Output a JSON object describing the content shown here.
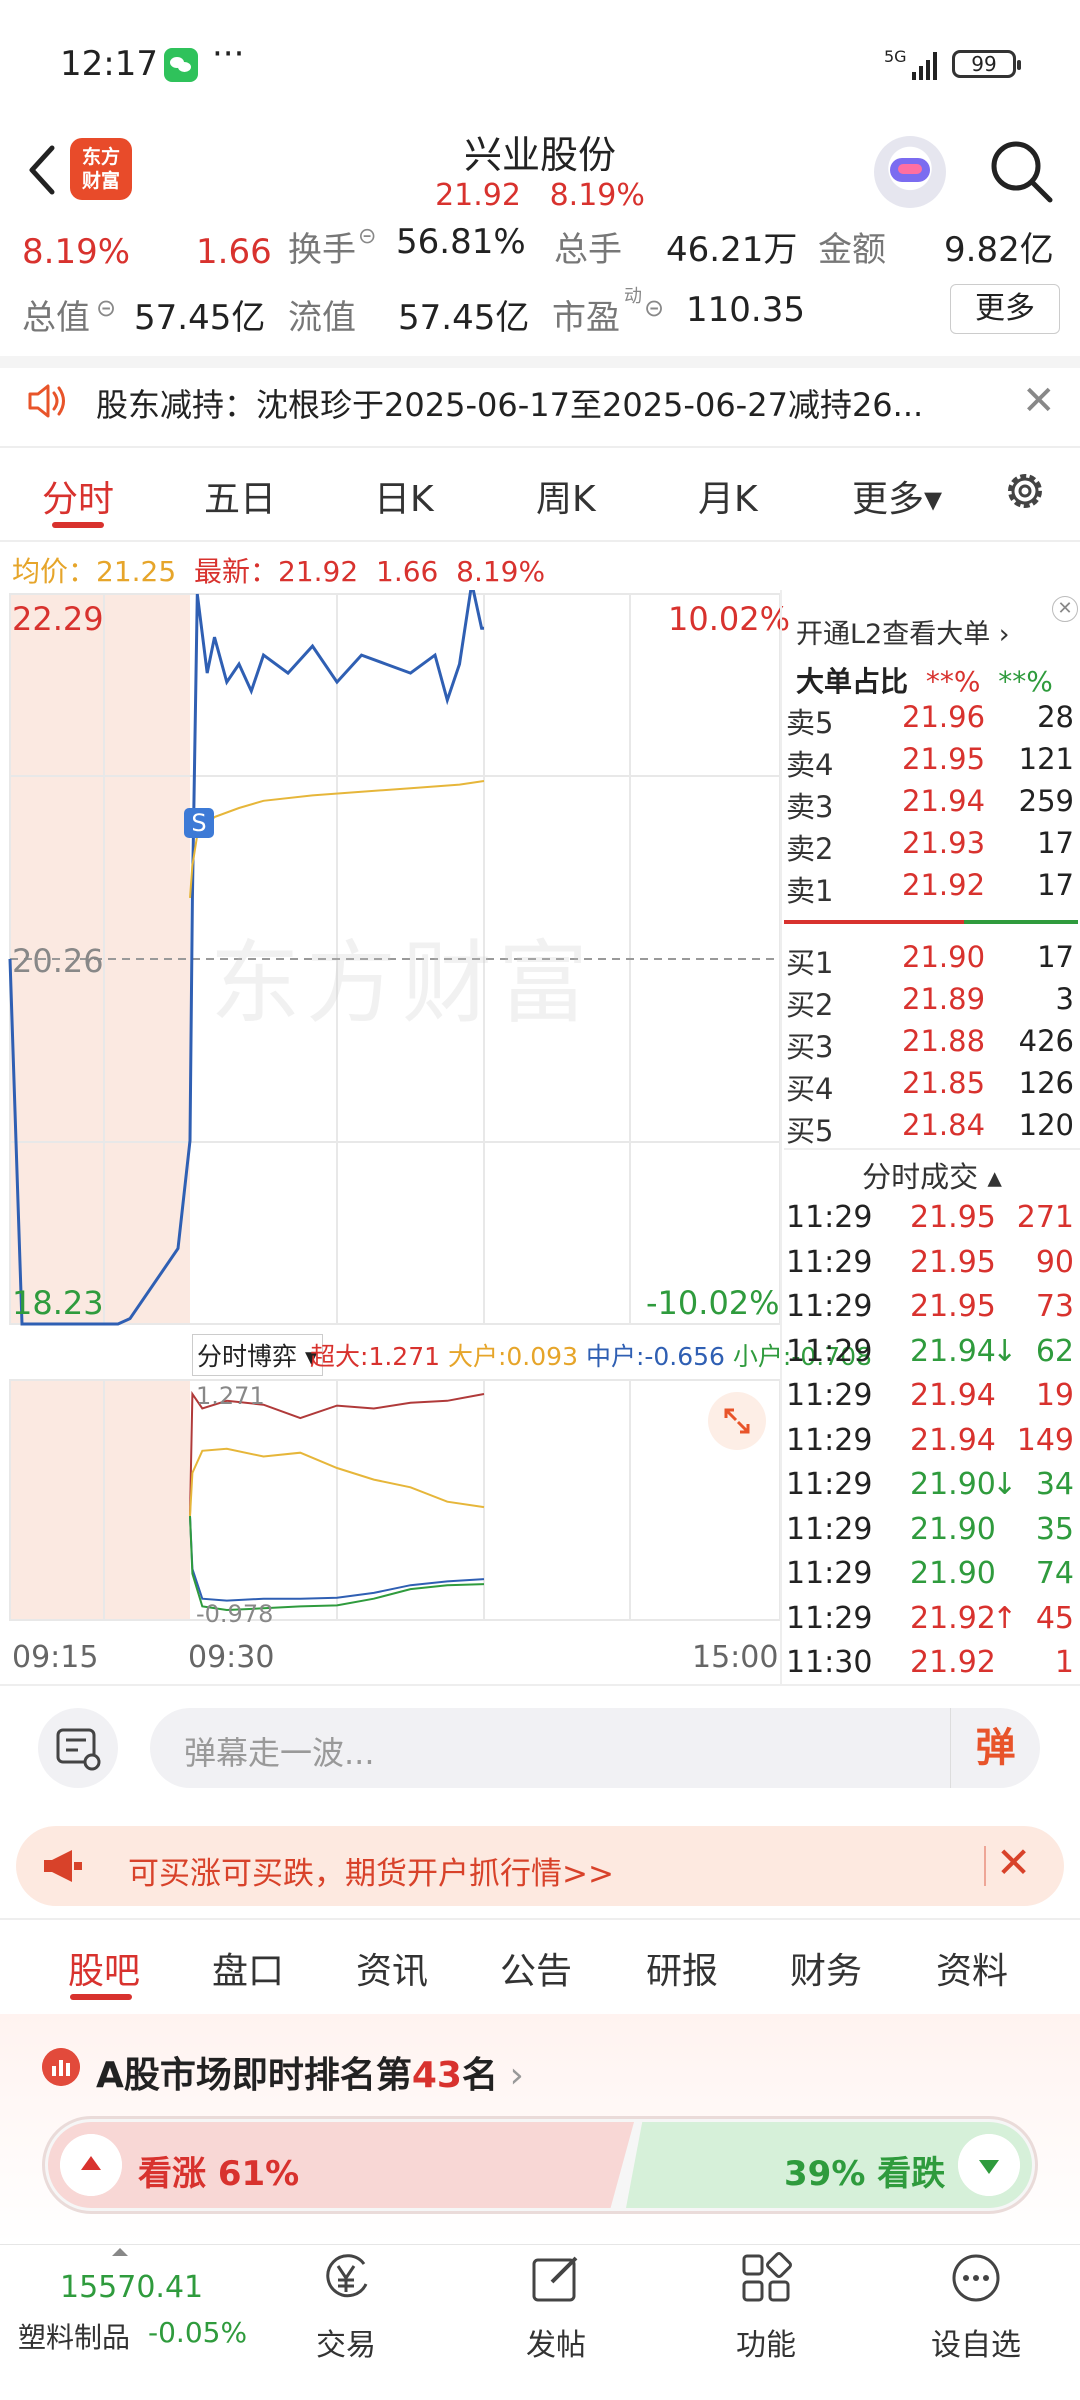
{
  "status_bar": {
    "time": "12:17",
    "more": "···",
    "network": "5G",
    "battery": "99"
  },
  "header": {
    "back": "back",
    "logo_line1": "东方",
    "logo_line2": "财富",
    "stock_name": "兴业股份",
    "price": "21.92",
    "change_pct": "8.19%"
  },
  "info_row1": {
    "pct": "8.19%",
    "chg": "1.66",
    "turnover_label": "换手",
    "turnover_value": "56.81%",
    "vol_label": "总手",
    "vol_value": "46.21万",
    "amount_label": "金额",
    "amount_value": "9.82亿"
  },
  "info_row2": {
    "cap_label": "总值",
    "cap_value": "57.45亿",
    "float_label": "流值",
    "float_value": "57.45亿",
    "pe_label": "市盈",
    "pe_sup": "动",
    "pe_value": "110.35",
    "more_label": "更多"
  },
  "notice": {
    "text": "股东减持：沈根珍于2025-06-17至2025-06-27减持26..."
  },
  "chart_tabs": {
    "items": [
      "分时",
      "五日",
      "日K",
      "周K",
      "月K",
      "更多▾"
    ]
  },
  "avg_row": {
    "avg_label": "均价：",
    "avg_value": "21.25",
    "last_label": "最新：",
    "last_value": "21.92",
    "chg": "1.66",
    "pct": "8.19%"
  },
  "chart_labels": {
    "hi": "22.29",
    "hi_pct": "10.02%",
    "mid": "20.26",
    "lo": "18.23",
    "lo_pct": "-10.02%",
    "watermark": "东方财富",
    "badge": "S"
  },
  "flow": {
    "select": "分时博弈 ▾",
    "super_label": "超大:",
    "super_value": "1.271",
    "big_label": "大户:",
    "big_value": "0.093",
    "mid_label": "中户:",
    "mid_value": "-0.656",
    "small_label": "小户:",
    "small_value": "-0.708",
    "axis_hi": "1.271",
    "axis_lo": "-0.978"
  },
  "time_axis": {
    "start": "09:15",
    "open": "09:30",
    "end": "15:00"
  },
  "orderbook": {
    "l2_text": "开通L2查看大单 ›",
    "big_order_label": "大单占比",
    "big_order_red": "**%",
    "big_order_green": "**%",
    "sell": [
      {
        "label": "卖5",
        "price": "21.96",
        "vol": "28"
      },
      {
        "label": "卖4",
        "price": "21.95",
        "vol": "121"
      },
      {
        "label": "卖3",
        "price": "21.94",
        "vol": "259"
      },
      {
        "label": "卖2",
        "price": "21.93",
        "vol": "17"
      },
      {
        "label": "卖1",
        "price": "21.92",
        "vol": "17"
      }
    ],
    "buy": [
      {
        "label": "买1",
        "price": "21.90",
        "vol": "17"
      },
      {
        "label": "买2",
        "price": "21.89",
        "vol": "3"
      },
      {
        "label": "买3",
        "price": "21.88",
        "vol": "426"
      },
      {
        "label": "买4",
        "price": "21.85",
        "vol": "126"
      },
      {
        "label": "买5",
        "price": "21.84",
        "vol": "120"
      }
    ],
    "trade_title": "分时成交 ▴",
    "trades": [
      {
        "time": "11:29",
        "price": "21.95",
        "dir": "",
        "vol": "271",
        "color": "red"
      },
      {
        "time": "11:29",
        "price": "21.95",
        "dir": "",
        "vol": "90",
        "color": "red"
      },
      {
        "time": "11:29",
        "price": "21.95",
        "dir": "",
        "vol": "73",
        "color": "red"
      },
      {
        "time": "11:29",
        "price": "21.94",
        "dir": "↓",
        "vol": "62",
        "color": "green"
      },
      {
        "time": "11:29",
        "price": "21.94",
        "dir": "",
        "vol": "19",
        "color": "red"
      },
      {
        "time": "11:29",
        "price": "21.94",
        "dir": "",
        "vol": "149",
        "color": "red"
      },
      {
        "time": "11:29",
        "price": "21.90",
        "dir": "↓",
        "vol": "34",
        "color": "green"
      },
      {
        "time": "11:29",
        "price": "21.90",
        "dir": "",
        "vol": "35",
        "color": "green"
      },
      {
        "time": "11:29",
        "price": "21.90",
        "dir": "",
        "vol": "74",
        "color": "green"
      },
      {
        "time": "11:29",
        "price": "21.92",
        "dir": "↑",
        "vol": "45",
        "color": "red"
      },
      {
        "time": "11:30",
        "price": "21.92",
        "dir": "",
        "vol": "1",
        "color": "red"
      }
    ]
  },
  "comment": {
    "placeholder": "弹幕走一波...",
    "danmu": "弹"
  },
  "promo": {
    "text": "可买涨可买跌，期货开户抓行情>>",
    "close": "✕"
  },
  "bottom_tabs": {
    "items": [
      "股吧",
      "盘口",
      "资讯",
      "公告",
      "研报",
      "财务",
      "资料"
    ]
  },
  "ranking": {
    "prefix": "A股市场即时排名第",
    "rank": "43",
    "suffix": "名"
  },
  "vote": {
    "up_label": "看涨 61%",
    "up_pct": 61,
    "down_label": "39% 看跌",
    "down_pct": 39
  },
  "bottom_nav": {
    "index_value": "15570.41",
    "index_name": "塑料制品",
    "index_pct": "-0.05%",
    "items": [
      {
        "label": "交易",
        "icon": "yen-icon"
      },
      {
        "label": "发帖",
        "icon": "edit-icon"
      },
      {
        "label": "功能",
        "icon": "grid-icon"
      },
      {
        "label": "设自选",
        "icon": "dots-icon"
      }
    ]
  },
  "colors": {
    "up": "#d8322e",
    "down": "#2f9b3d",
    "price_line": "#2f5fb3",
    "avg_line": "#e6b63a",
    "accent": "#e8542a"
  },
  "chart_data": {
    "type": "line",
    "title": "",
    "ylim": [
      18.23,
      22.29
    ],
    "pct_range": [
      "-10.02%",
      "10.02%"
    ],
    "prev_close": 20.26,
    "x_ticks": [
      "09:15",
      "09:30",
      "15:00"
    ],
    "series": [
      {
        "name": "price",
        "color": "#2f5fb3",
        "x": [
          "09:15",
          "09:16",
          "09:20",
          "09:24",
          "09:25",
          "09:29",
          "09:30",
          "09:31",
          "09:33",
          "09:37",
          "09:40",
          "09:45",
          "09:50",
          "09:55",
          "10:00",
          "10:10",
          "10:20",
          "10:30",
          "10:40",
          "10:50",
          "11:00",
          "11:10",
          "11:15",
          "11:20",
          "11:25",
          "11:29",
          "11:30"
        ],
        "values": [
          20.26,
          18.23,
          18.23,
          18.23,
          18.26,
          18.65,
          19.25,
          20.6,
          22.29,
          21.85,
          22.05,
          21.8,
          21.9,
          21.75,
          21.95,
          21.85,
          22.0,
          21.8,
          21.95,
          21.9,
          21.85,
          21.95,
          21.7,
          21.9,
          22.35,
          22.1,
          22.1
        ]
      },
      {
        "name": "avg",
        "color": "#e6b63a",
        "x": [
          "09:30",
          "09:31",
          "09:33",
          "09:40",
          "09:50",
          "10:00",
          "10:20",
          "10:40",
          "11:00",
          "11:20",
          "11:30"
        ],
        "values": [
          20.6,
          20.78,
          20.95,
          21.05,
          21.1,
          21.14,
          21.17,
          21.19,
          21.21,
          21.23,
          21.25
        ]
      }
    ],
    "flow_series": [
      {
        "name": "超大",
        "color": "#b03a3a",
        "x": [
          "09:30",
          "09:31",
          "09:35",
          "09:45",
          "10:00",
          "10:15",
          "10:30",
          "10:45",
          "11:00",
          "11:15",
          "11:30"
        ],
        "values": [
          0.0,
          1.271,
          1.12,
          1.2,
          1.16,
          1.02,
          1.15,
          1.12,
          1.18,
          1.2,
          1.271
        ]
      },
      {
        "name": "大户",
        "color": "#e6b63a",
        "x": [
          "09:30",
          "09:31",
          "09:35",
          "09:45",
          "10:00",
          "10:15",
          "10:30",
          "10:45",
          "11:00",
          "11:15",
          "11:30"
        ],
        "values": [
          0.0,
          0.45,
          0.68,
          0.7,
          0.62,
          0.66,
          0.5,
          0.38,
          0.3,
          0.15,
          0.093
        ]
      },
      {
        "name": "中户",
        "color": "#2f5fb3",
        "x": [
          "09:30",
          "09:31",
          "09:35",
          "09:45",
          "10:00",
          "10:15",
          "10:30",
          "10:45",
          "11:00",
          "11:15",
          "11:30"
        ],
        "values": [
          0.0,
          -0.55,
          -0.86,
          -0.88,
          -0.86,
          -0.86,
          -0.85,
          -0.8,
          -0.72,
          -0.68,
          -0.656
        ]
      },
      {
        "name": "小户",
        "color": "#2f9b3d",
        "x": [
          "09:30",
          "09:31",
          "09:35",
          "09:45",
          "10:00",
          "10:15",
          "10:30",
          "10:45",
          "11:00",
          "11:15",
          "11:30"
        ],
        "values": [
          0.0,
          -0.6,
          -0.94,
          -0.978,
          -0.96,
          -0.94,
          -0.93,
          -0.86,
          -0.76,
          -0.72,
          -0.708
        ]
      }
    ]
  }
}
